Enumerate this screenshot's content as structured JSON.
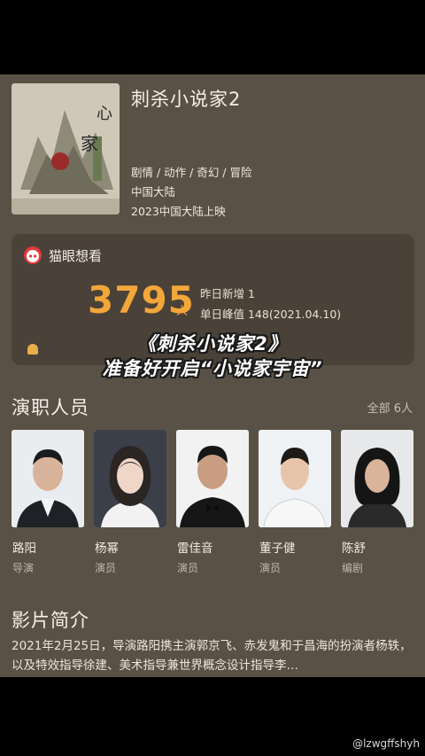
{
  "movie": {
    "title": "刺杀小说家2",
    "genres": "剧情 / 动作 / 奇幻 / 冒险",
    "region": "中国大陆",
    "release": "2023中国大陆上映"
  },
  "want_card": {
    "brand": "猫眼想看",
    "count": "3795",
    "unit": "人",
    "yesterday": "昨日新增 1",
    "peak": "单日峰值 148(2021.04.10)"
  },
  "overlay": {
    "line1": "《刺杀小说家2》",
    "line2": "准备好开启“小说家宇宙”"
  },
  "cast": {
    "title": "演职人员",
    "all_label": "全部 6人",
    "members": [
      {
        "name": "路阳",
        "role": "导演"
      },
      {
        "name": "杨幂",
        "role": "演员"
      },
      {
        "name": "雷佳音",
        "role": "演员"
      },
      {
        "name": "董子健",
        "role": "演员"
      },
      {
        "name": "陈舒",
        "role": "编剧"
      }
    ]
  },
  "intro": {
    "title": "影片简介",
    "text": "2021年2月25日，导演路阳携主演郭京飞、赤发鬼和于昌海的扮演者杨轶，以及特效指导徐建、美术指导兼世界概念设计指导李…"
  },
  "watermark": "@lzwgffshyh",
  "colors": {
    "background": "#5a5146",
    "card": "#4a4238",
    "accent": "#f3a63a"
  }
}
